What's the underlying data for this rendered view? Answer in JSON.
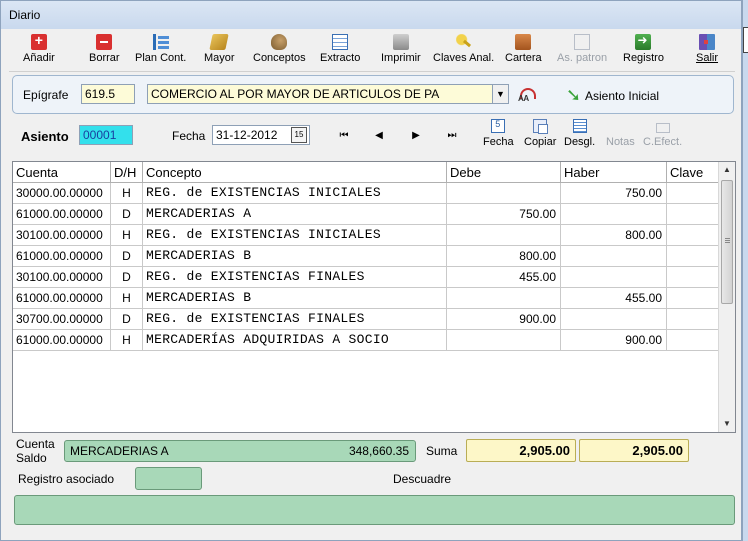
{
  "window": {
    "title": "Diario"
  },
  "toolbar": [
    {
      "label": "Añadir",
      "icon": "add-icon",
      "enabled": true
    },
    {
      "label": "Borrar",
      "icon": "delete-icon",
      "enabled": true
    },
    {
      "label": "Plan Cont.",
      "icon": "chart-of-accounts-icon",
      "enabled": true
    },
    {
      "label": "Mayor",
      "icon": "ledger-icon",
      "enabled": true
    },
    {
      "label": "Conceptos",
      "icon": "concepts-icon",
      "enabled": true
    },
    {
      "label": "Extracto",
      "icon": "statement-icon",
      "enabled": true
    },
    {
      "label": "Imprimir",
      "icon": "printer-icon",
      "enabled": true
    },
    {
      "label": "Claves Anal.",
      "icon": "key-icon",
      "enabled": true
    },
    {
      "label": "Cartera",
      "icon": "briefcase-icon",
      "enabled": true
    },
    {
      "label": "As. patron",
      "icon": "template-icon",
      "enabled": false
    },
    {
      "label": "Registro",
      "icon": "register-icon",
      "enabled": true
    },
    {
      "label": "Salir",
      "icon": "exit-door-icon",
      "enabled": true
    }
  ],
  "epigrafe": {
    "label": "Epígrafe",
    "code": "619.5",
    "description": "COMERCIO AL POR MAYOR DE ARTICULOS DE PA",
    "asiento_inicial_label": "Asiento Inicial"
  },
  "asiento": {
    "label": "Asiento",
    "number": "00001",
    "fecha_label": "Fecha",
    "fecha": "31-12-2012",
    "calendar_glyph": "15"
  },
  "nav_buttons": [
    {
      "glyph": "⏮",
      "name": "first-record-icon"
    },
    {
      "glyph": "◀",
      "name": "previous-record-icon"
    },
    {
      "glyph": "▶",
      "name": "next-record-icon"
    },
    {
      "glyph": "⏭",
      "name": "last-record-icon"
    }
  ],
  "actions": [
    {
      "label": "Fecha",
      "icon": "date-icon",
      "enabled": true
    },
    {
      "label": "Copiar",
      "icon": "copy-icon",
      "enabled": true
    },
    {
      "label": "Desgl.",
      "icon": "breakdown-icon",
      "enabled": true
    },
    {
      "label": "Notas",
      "icon": "notes-icon",
      "enabled": false
    },
    {
      "label": "C.Efect.",
      "icon": "cash-effect-icon",
      "enabled": false
    }
  ],
  "grid": {
    "columns": [
      "Cuenta",
      "D/H",
      "Concepto",
      "Debe",
      "Haber",
      "Clave"
    ],
    "rows": [
      {
        "cuenta": "30000.00.00000",
        "dh": "H",
        "concepto": "REG. de EXISTENCIAS INICIALES",
        "debe": "",
        "haber": "750.00",
        "clave": ""
      },
      {
        "cuenta": "61000.00.00000",
        "dh": "D",
        "concepto": "MERCADERIAS A",
        "debe": "750.00",
        "haber": "",
        "clave": ""
      },
      {
        "cuenta": "30100.00.00000",
        "dh": "H",
        "concepto": "REG. de EXISTENCIAS INICIALES",
        "debe": "",
        "haber": "800.00",
        "clave": ""
      },
      {
        "cuenta": "61000.00.00000",
        "dh": "D",
        "concepto": "MERCADERIAS B",
        "debe": "800.00",
        "haber": "",
        "clave": ""
      },
      {
        "cuenta": "30100.00.00000",
        "dh": "D",
        "concepto": "REG. de EXISTENCIAS FINALES",
        "debe": "455.00",
        "haber": "",
        "clave": ""
      },
      {
        "cuenta": "61000.00.00000",
        "dh": "H",
        "concepto": "MERCADERIAS B",
        "debe": "",
        "haber": "455.00",
        "clave": ""
      },
      {
        "cuenta": "30700.00.00000",
        "dh": "D",
        "concepto": "REG. de EXISTENCIAS FINALES",
        "debe": "900.00",
        "haber": "",
        "clave": ""
      },
      {
        "cuenta": "61000.00.00000",
        "dh": "H",
        "concepto": "MERCADERÍAS ADQUIRIDAS A SOCIO",
        "debe": "",
        "haber": "900.00",
        "clave": ""
      }
    ]
  },
  "footer": {
    "cuenta_label": "Cuenta",
    "saldo_label": "Saldo",
    "account_name": "MERCADERIAS A",
    "account_balance": "348,660.35",
    "suma_label": "Suma",
    "suma_debe": "2,905.00",
    "suma_haber": "2,905.00",
    "registro_label": "Registro asociado",
    "descuadre_label": "Descuadre"
  },
  "colors": {
    "accent_green": "#a8d8b8",
    "input_yellow": "#fdf7c8",
    "asiento_cyan": "#33e0ec"
  }
}
